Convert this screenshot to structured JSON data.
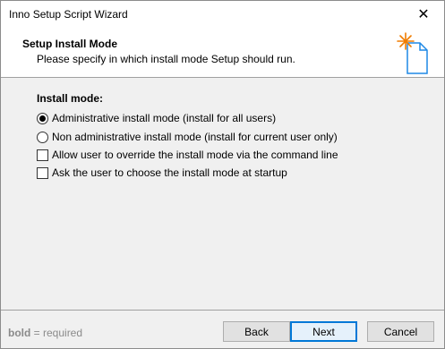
{
  "window": {
    "title": "Inno Setup Script Wizard",
    "close_glyph": "✕"
  },
  "header": {
    "title": "Setup Install Mode",
    "subtitle": "Please specify in which install mode Setup should run.",
    "icon": "setup-wizard-document-icon"
  },
  "group": {
    "label": "Install mode:"
  },
  "options": [
    {
      "type": "radio",
      "label": "Administrative install mode (install for all users)",
      "checked": true
    },
    {
      "type": "radio",
      "label": "Non administrative install mode (install for current user only)",
      "checked": false
    },
    {
      "type": "checkbox",
      "label": "Allow user to override the install mode via the command line",
      "checked": false
    },
    {
      "type": "checkbox",
      "label": "Ask the user to choose the install mode at startup",
      "checked": false
    }
  ],
  "footer": {
    "note_bold": "bold",
    "note_rest": " = required",
    "buttons": {
      "back": "Back",
      "next": "Next",
      "cancel": "Cancel"
    }
  },
  "colors": {
    "accent": "#0078d7",
    "icon_star": "#f07c00",
    "icon_doc": "#1e88e5"
  }
}
